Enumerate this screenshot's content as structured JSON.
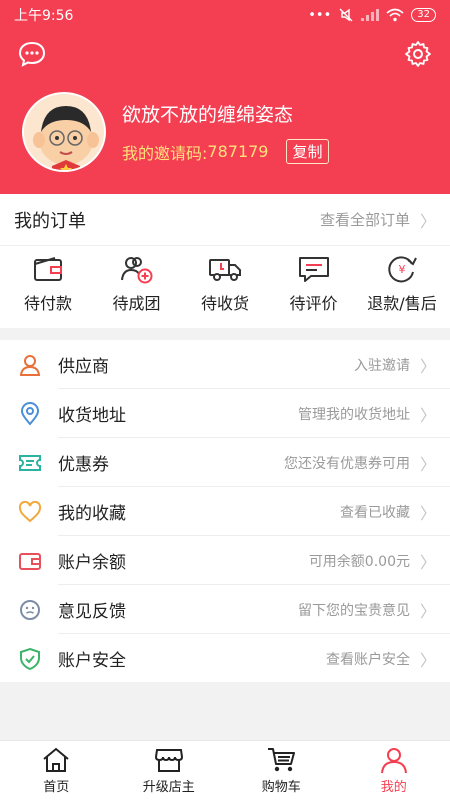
{
  "status_bar": {
    "time": "上午9:56",
    "dots": "•••",
    "battery": "32"
  },
  "profile": {
    "username": "欲放不放的缠绵姿态",
    "invite_label": "我的邀请码:",
    "invite_code": "787179",
    "copy_label": "复制"
  },
  "orders": {
    "title": "我的订单",
    "view_all": "查看全部订单",
    "items": [
      {
        "label": "待付款",
        "icon": "wallet-icon"
      },
      {
        "label": "待成团",
        "icon": "group-add-icon"
      },
      {
        "label": "待收货",
        "icon": "truck-icon"
      },
      {
        "label": "待评价",
        "icon": "comment-icon"
      },
      {
        "label": "退款/售后",
        "icon": "refund-icon"
      }
    ]
  },
  "menu": [
    {
      "label": "供应商",
      "right": "入驻邀请",
      "icon": "person-icon",
      "color": "#e8703a"
    },
    {
      "label": "收货地址",
      "right": "管理我的收货地址",
      "icon": "location-icon",
      "color": "#4a90d9"
    },
    {
      "label": "优惠券",
      "right": "您还没有优惠券可用",
      "icon": "ticket-icon",
      "color": "#2cb3a0"
    },
    {
      "label": "我的收藏",
      "right": "查看已收藏",
      "icon": "heart-icon",
      "color": "#f2a93b"
    },
    {
      "label": "账户余额",
      "right": "可用余额0.00元",
      "icon": "wallet-icon",
      "color": "#e8505b"
    },
    {
      "label": "意见反馈",
      "right": "留下您的宝贵意见",
      "icon": "feedback-icon",
      "color": "#7d8da6"
    },
    {
      "label": "账户安全",
      "right": "查看账户安全",
      "icon": "shield-icon",
      "color": "#3bb56a"
    }
  ],
  "tabs": [
    {
      "label": "首页",
      "icon": "home-icon"
    },
    {
      "label": "升级店主",
      "icon": "store-icon"
    },
    {
      "label": "购物车",
      "icon": "cart-icon"
    },
    {
      "label": "我的",
      "icon": "user-icon"
    }
  ],
  "colors": {
    "brand": "#f43f53",
    "invite": "#ffe07a"
  }
}
